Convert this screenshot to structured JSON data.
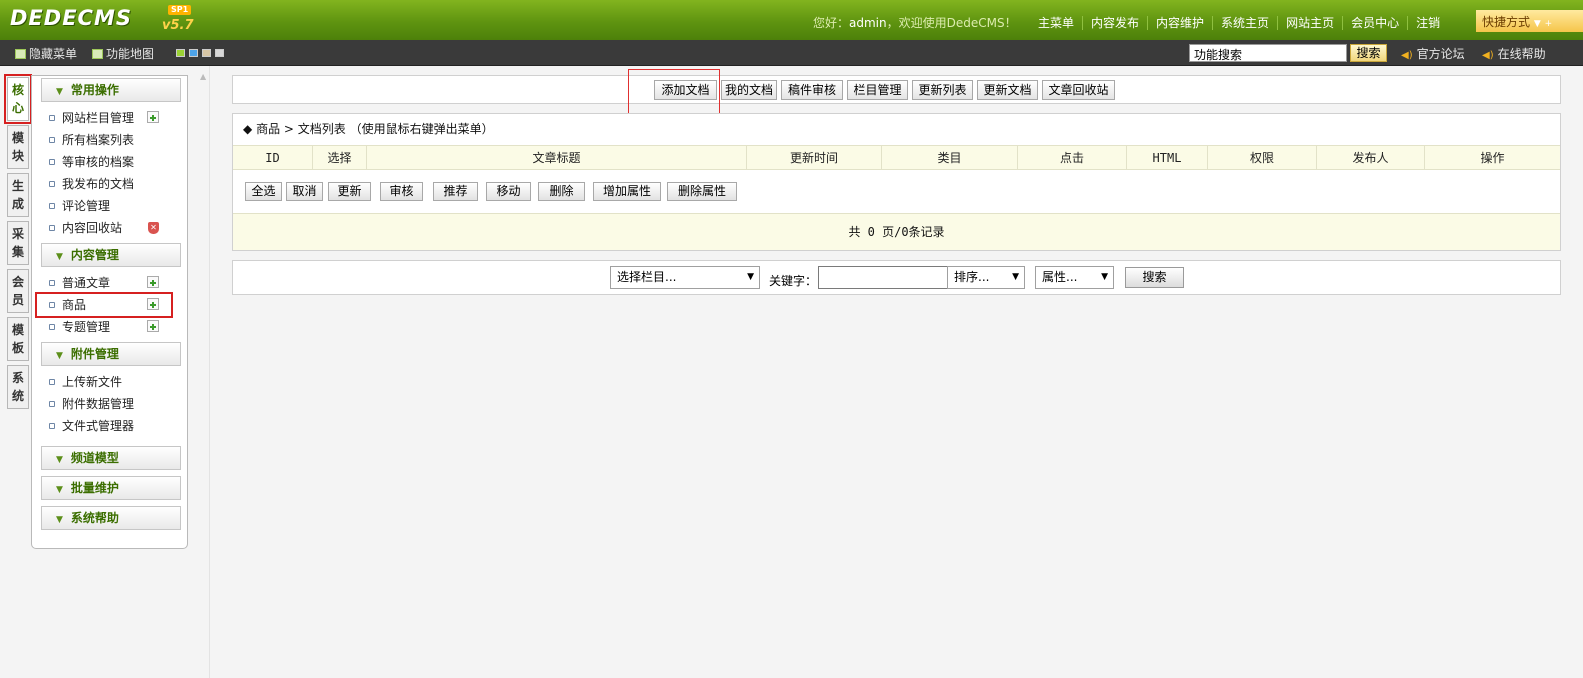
{
  "header": {
    "logo": "DEDECMS",
    "version": "v5.7",
    "badge": "SP1",
    "greeting_prefix": "您好：",
    "username": "admin",
    "greeting_suffix": "，欢迎使用DedeCMS！",
    "nav": [
      "主菜单",
      "内容发布",
      "内容维护",
      "系统主页",
      "网站主页",
      "会员中心",
      "注销"
    ],
    "quick_label": "快捷方式"
  },
  "subbar": {
    "hide_menu": "隐藏菜单",
    "function_map": "功能地图",
    "search_value": "功能搜索",
    "search_button": "搜索",
    "forum": "官方论坛",
    "help": "在线帮助",
    "swatch_colors": [
      "#9bd234",
      "#4da3e8",
      "#d8c7a6",
      "#d8d8d8"
    ]
  },
  "tabs": [
    {
      "label": "核心",
      "active": true
    },
    {
      "label": "模块"
    },
    {
      "label": "生成"
    },
    {
      "label": "采集"
    },
    {
      "label": "会员"
    },
    {
      "label": "模板"
    },
    {
      "label": "系统"
    }
  ],
  "menu": {
    "common_ops": {
      "title": "常用操作",
      "items": [
        "网站栏目管理",
        "所有档案列表",
        "等审核的档案",
        "我发布的文档",
        "评论管理",
        "内容回收站"
      ]
    },
    "content_mgmt": {
      "title": "内容管理",
      "items": [
        "普通文章",
        "商品",
        "专题管理"
      ]
    },
    "attachment_mgmt": {
      "title": "附件管理",
      "items": [
        "上传新文件",
        "附件数据管理",
        "文件式管理器"
      ]
    },
    "channel_model": {
      "title": "频道模型"
    },
    "batch_maint": {
      "title": "批量维护"
    },
    "system_help": {
      "title": "系统帮助"
    }
  },
  "toolbar": {
    "buttons": [
      "添加文档",
      "我的文档",
      "稿件审核",
      "栏目管理",
      "更新列表",
      "更新文档",
      "文章回收站"
    ]
  },
  "list": {
    "breadcrumb_marker": "◆",
    "breadcrumb": "商品 > 文档列表",
    "hint": "（使用鼠标右键弹出菜单）",
    "columns": [
      "ID",
      "选择",
      "文章标题",
      "更新时间",
      "类目",
      "点击",
      "HTML",
      "权限",
      "发布人",
      "操作"
    ],
    "actions": [
      "全选",
      "取消",
      "更新",
      "审核",
      "推荐",
      "移动",
      "删除",
      "增加属性",
      "删除属性"
    ],
    "summary": "共 0 页/0条记录"
  },
  "filter": {
    "category": "选择栏目...",
    "keyword_label": "关键字：",
    "keyword_value": "",
    "order": "排序...",
    "attribute": "属性...",
    "search_button": "搜索"
  }
}
